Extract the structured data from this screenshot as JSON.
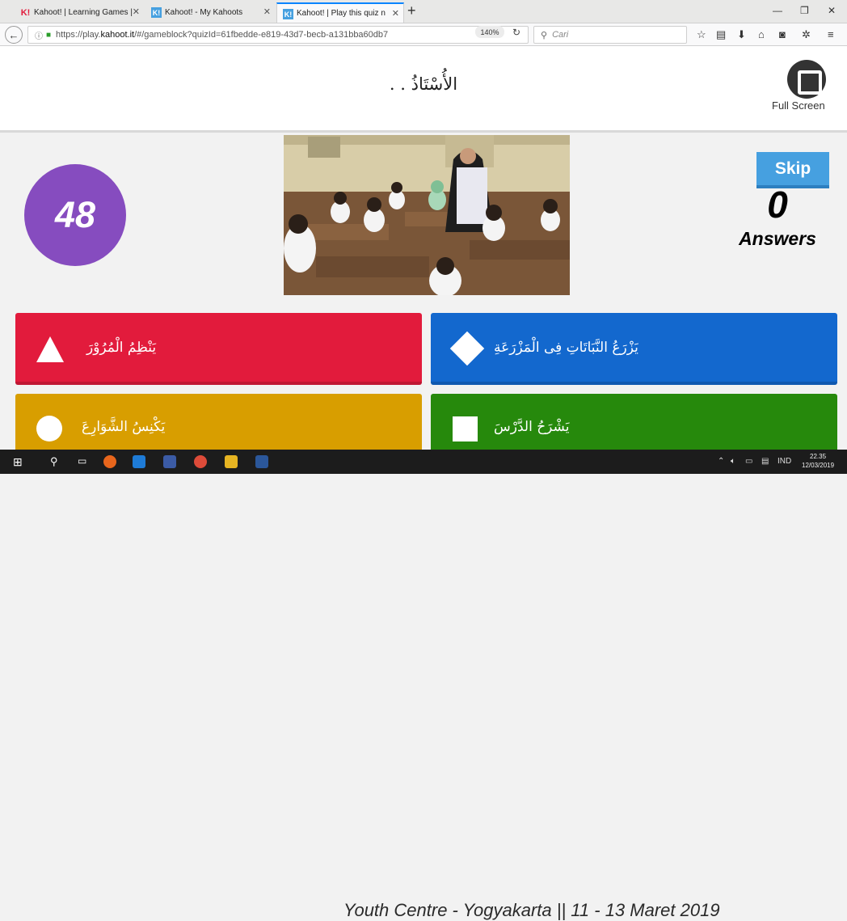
{
  "browser": {
    "tabs": [
      {
        "favicon": "K!",
        "favicon_color": "#e21b3c",
        "title": "Kahoot! | Learning Games | "
      },
      {
        "favicon": "K!",
        "favicon_color": "#46a0e0",
        "title": "Kahoot! - My Kahoots"
      },
      {
        "favicon": "K!",
        "favicon_color": "#46a0e0",
        "title": "Kahoot! | Play this quiz n"
      }
    ],
    "url_prefix": "https://play.",
    "url_domain": "kahoot.it",
    "url_suffix": "/#/gameblock?quizId=61fbedde-e819-43d7-becb-a131bba60db7",
    "zoom": "140%",
    "search_placeholder": "Cari"
  },
  "game": {
    "question": "الأُسْتَاذُ . .",
    "fullscreen_label": "Full Screen",
    "timer": "48",
    "skip_label": "Skip",
    "answers_count": "0",
    "answers_label": "Answers",
    "answers": [
      {
        "shape": "triangle",
        "color": "#e21b3c",
        "text": "يَنْظِمُ الْمُرُوْرَ"
      },
      {
        "shape": "diamond",
        "color": "#1368ce",
        "text": "يَزْرَعُ النَّبَاتَاتِ فِى الْمَزْرَعَةِ"
      },
      {
        "shape": "circle",
        "color": "#d89e00",
        "text": "يَكْنِسُ الشَّوَارِعَ"
      },
      {
        "shape": "square",
        "color": "#26890c",
        "text": "يَشْرَحُ الدَّرْسَ"
      }
    ]
  },
  "taskbar": {
    "watermark": "Youth Centre - Yogyakarta || 11 - 13 Maret 2019",
    "language": "IND",
    "time": "22.35",
    "date": "12/03/2019"
  }
}
